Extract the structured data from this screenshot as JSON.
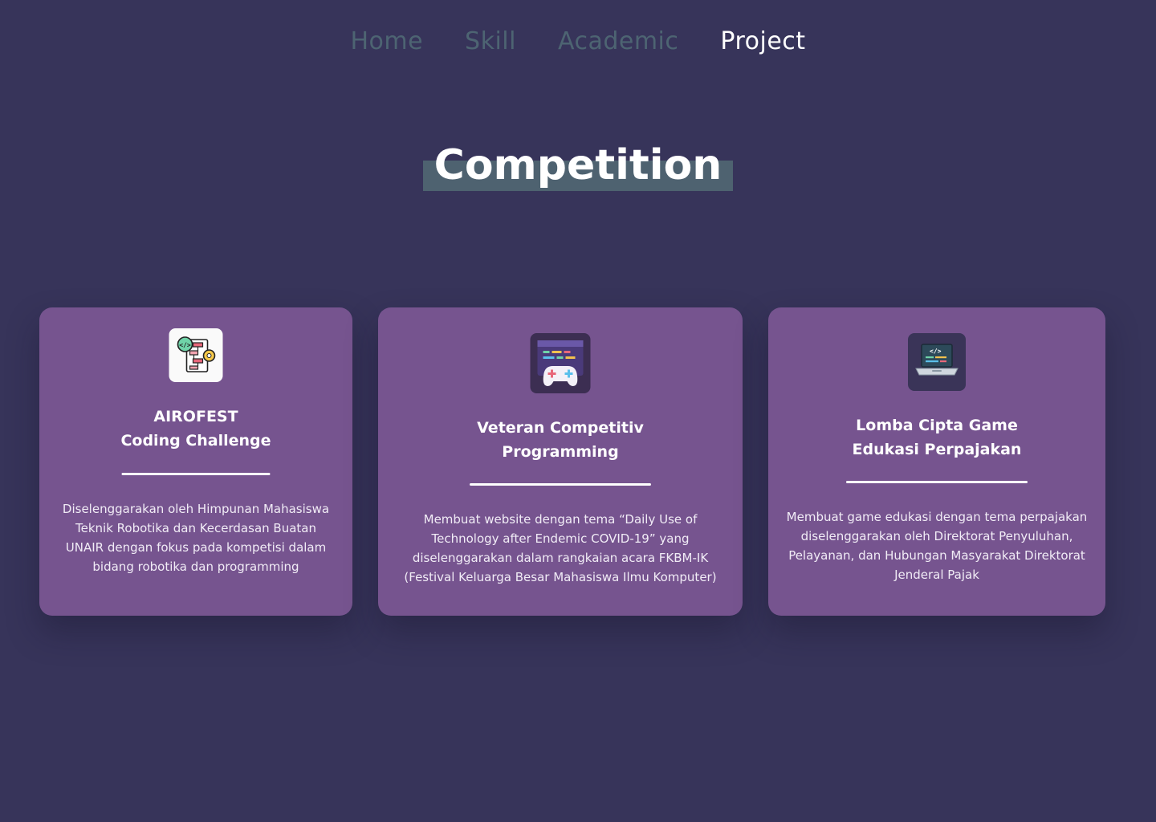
{
  "nav": {
    "items": [
      {
        "label": "Home"
      },
      {
        "label": "Skill"
      },
      {
        "label": "Academic"
      },
      {
        "label": "Project"
      }
    ],
    "active": "Project"
  },
  "section": {
    "title": "Competition"
  },
  "cards": [
    {
      "icon": "flowchart-code-icon",
      "title_line1": "AIROFEST",
      "title_line2": "Coding Challenge",
      "description": "Diselenggarakan oleh Himpunan Mahasiswa Teknik Robotika dan Kecerdasan Buatan UNAIR dengan fokus pada kompetisi dalam bidang robotika dan programming"
    },
    {
      "icon": "gamepad-screen-icon",
      "title_line1": "Veteran Competitiv",
      "title_line2": "Programming",
      "description": "Membuat website dengan tema “Daily Use of Technology after Endemic COVID-19” yang diselenggarakan dalam rangkaian acara FKBM-IK (Festival Keluarga Besar Mahasiswa Ilmu Komputer)"
    },
    {
      "icon": "laptop-code-icon",
      "title_line1": "Lomba Cipta Game",
      "title_line2": "Edukasi Perpajakan",
      "description": "Membuat game edukasi dengan tema perpajakan diselenggarakan oleh Direktorat Penyuluhan, Pelayanan, dan Hubungan Masyarakat Direktorat Jenderal Pajak"
    }
  ],
  "colors": {
    "background": "#37345a",
    "card": "#76548f",
    "nav_inactive": "#4d6472",
    "nav_active": "#ffffff",
    "title_highlight": "#4e6270"
  }
}
